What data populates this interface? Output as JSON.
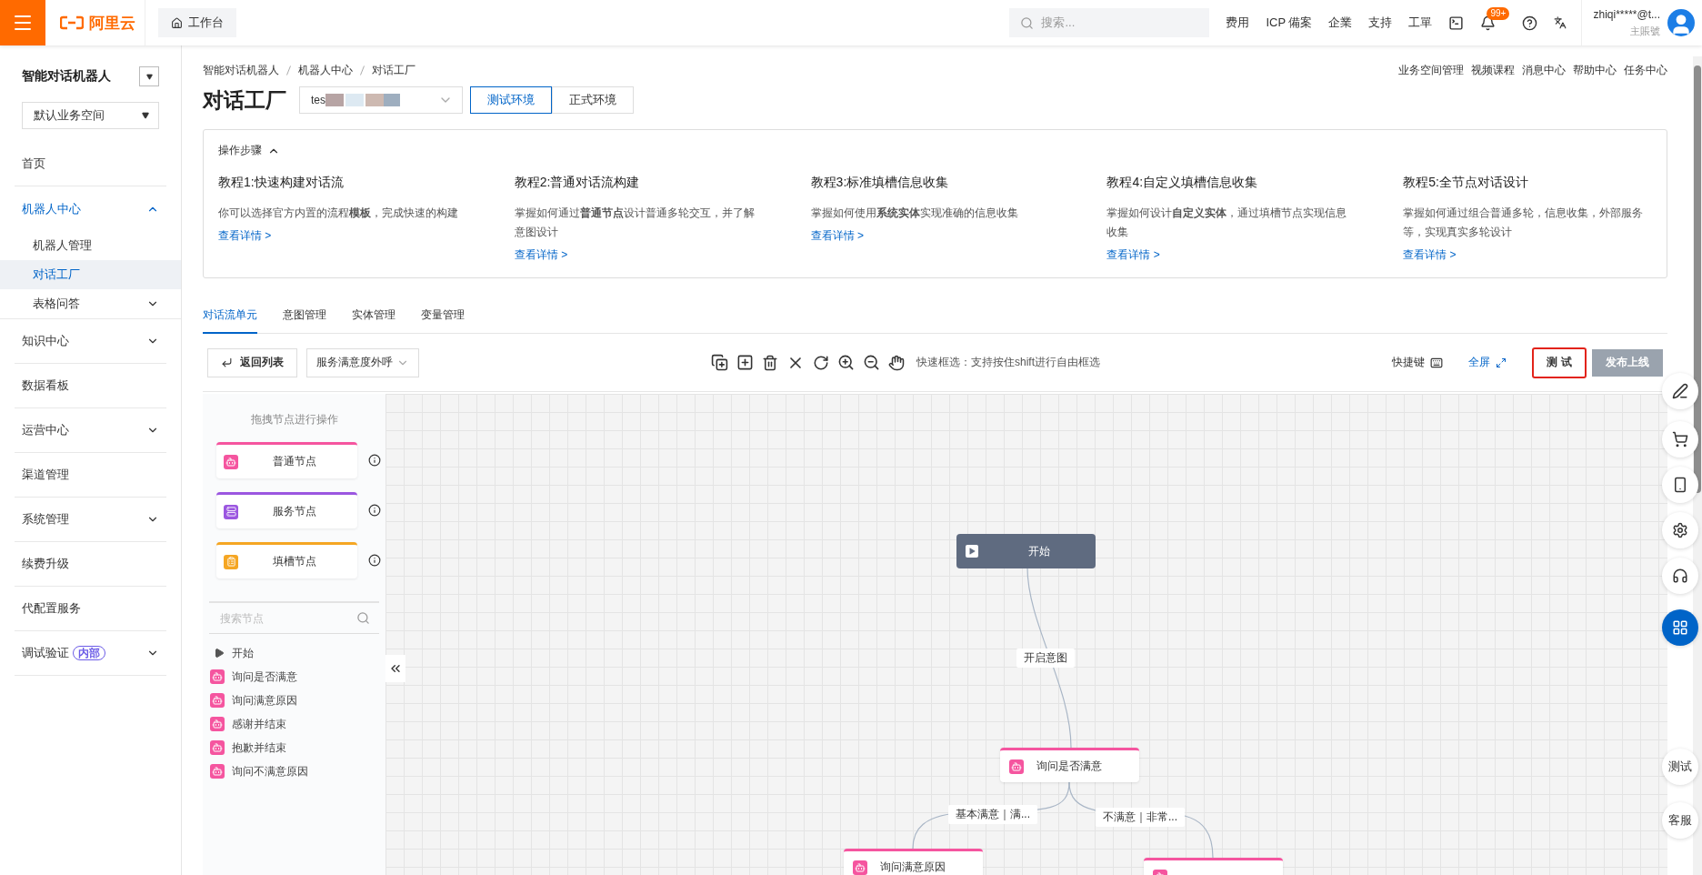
{
  "topbar": {
    "logo": "阿里云",
    "workbench": "工作台",
    "search": {
      "placeholder": "搜索..."
    },
    "links": [
      "费用",
      "ICP 備案",
      "企業",
      "支持",
      "工單"
    ],
    "notification_badge": "99+",
    "user": {
      "name": "zhiqi*****@t...",
      "account_type": "主賬號"
    }
  },
  "sidebar": {
    "title": "智能对话机器人",
    "workspace": "默认业务空间",
    "items": [
      {
        "label": "首页",
        "selected": false
      },
      {
        "label": "机器人中心",
        "selected": true,
        "expanded": true,
        "children": [
          {
            "label": "机器人管理",
            "selected": false
          },
          {
            "label": "对话工厂",
            "selected": true
          },
          {
            "label": "表格问答",
            "selected": false,
            "expanded": false
          }
        ]
      },
      {
        "label": "知识中心",
        "selected": false,
        "expanded": false
      },
      {
        "label": "数据看板",
        "selected": false
      },
      {
        "label": "运营中心",
        "selected": false,
        "expanded": false
      },
      {
        "label": "渠道管理",
        "selected": false
      },
      {
        "label": "系统管理",
        "selected": false,
        "expanded": false
      },
      {
        "label": "续费升级",
        "selected": false
      },
      {
        "label": "代配置服务",
        "selected": false
      },
      {
        "label": "调试验证",
        "badge": "内部",
        "selected": false,
        "expanded": false
      }
    ]
  },
  "header": {
    "breadcrumb": [
      "智能对话机器人",
      "机器人中心",
      "对话工厂"
    ],
    "title": "对话工厂",
    "bot_select": {
      "value": "tes"
    },
    "environments": [
      {
        "label": "测试环境",
        "selected": true
      },
      {
        "label": "正式环境",
        "selected": false
      }
    ],
    "links": [
      "业务空间管理",
      "视频课程",
      "消息中心",
      "帮助中心",
      "任务中心"
    ]
  },
  "steps": {
    "title": "操作步骤",
    "expanded": true,
    "tutorials": [
      {
        "title": "教程1:快速构建对话流",
        "description": "你可以选择官方内置的流程**模板**，完成快速的构建",
        "link": "查看详情 >"
      },
      {
        "title": "教程2:普通对话流构建",
        "description": "掌握如何通过**普通节点**设计普通多轮交互，并了解意图设计",
        "link": "查看详情 >"
      },
      {
        "title": "教程3:标准填槽信息收集",
        "description": "掌握如何使用**系统实体**实现准确的信息收集",
        "link": "查看详情 >"
      },
      {
        "title": "教程4:自定义填槽信息收集",
        "description": "掌握如何设计**自定义实体**，通过填槽节点实现信息收集",
        "link": "查看详情 >"
      },
      {
        "title": "教程5:全节点对话设计",
        "description": "掌握如何通过组合普通多轮，信息收集，外部服务等，实现真实多轮设计",
        "link": "查看详情 >"
      }
    ]
  },
  "tabs": [
    {
      "label": "对话流单元",
      "selected": true
    },
    {
      "label": "意图管理",
      "selected": false
    },
    {
      "label": "实体管理",
      "selected": false
    },
    {
      "label": "变量管理",
      "selected": false
    }
  ],
  "toolbar": {
    "back": "返回列表",
    "flow_select": {
      "value": "服务满意度外呼"
    },
    "hint": "快速框选：支持按住shift进行自由框选",
    "shortcuts": "快捷键",
    "fullscreen": "全屏",
    "test": {
      "label": "测 试",
      "highlighted": true
    },
    "publish": {
      "label": "发布上线",
      "disabled": true
    }
  },
  "palette": {
    "hint": "拖拽节点进行操作",
    "node_types": [
      {
        "label": "普通节点",
        "color": "#f5559f"
      },
      {
        "label": "服务节点",
        "color": "#9b56e0"
      },
      {
        "label": "填槽节点",
        "color": "#f5a623"
      }
    ],
    "search": {
      "placeholder": "搜索节点"
    },
    "tree": [
      {
        "label": "开始",
        "kind": "start"
      },
      {
        "label": "询问是否满意",
        "kind": "dialog"
      },
      {
        "label": "询问满意原因",
        "kind": "dialog"
      },
      {
        "label": "感谢并结束",
        "kind": "dialog"
      },
      {
        "label": "抱歉并结束",
        "kind": "dialog"
      },
      {
        "label": "询问不满意原因",
        "kind": "dialog"
      }
    ]
  },
  "canvas": {
    "nodes": [
      {
        "label": "开始",
        "kind": "start"
      },
      {
        "label": "询问是否满意",
        "kind": "dialog"
      },
      {
        "label": "询问满意原因",
        "kind": "dialog"
      },
      {
        "kind": "dialog"
      }
    ],
    "edges": [
      {
        "label": "开启意图"
      },
      {
        "label": "基本满意｜满..."
      },
      {
        "label": "不满意｜非常..."
      }
    ]
  },
  "floating": [
    {
      "kind": "edit",
      "selected": false
    },
    {
      "kind": "cart",
      "selected": false
    },
    {
      "kind": "app",
      "selected": false
    },
    {
      "kind": "settings",
      "selected": false
    },
    {
      "kind": "support",
      "selected": false
    },
    {
      "kind": "apps",
      "selected": true
    },
    {
      "kind": "text",
      "label": "测试",
      "selected": false
    },
    {
      "kind": "text",
      "label": "客服",
      "selected": false
    }
  ]
}
